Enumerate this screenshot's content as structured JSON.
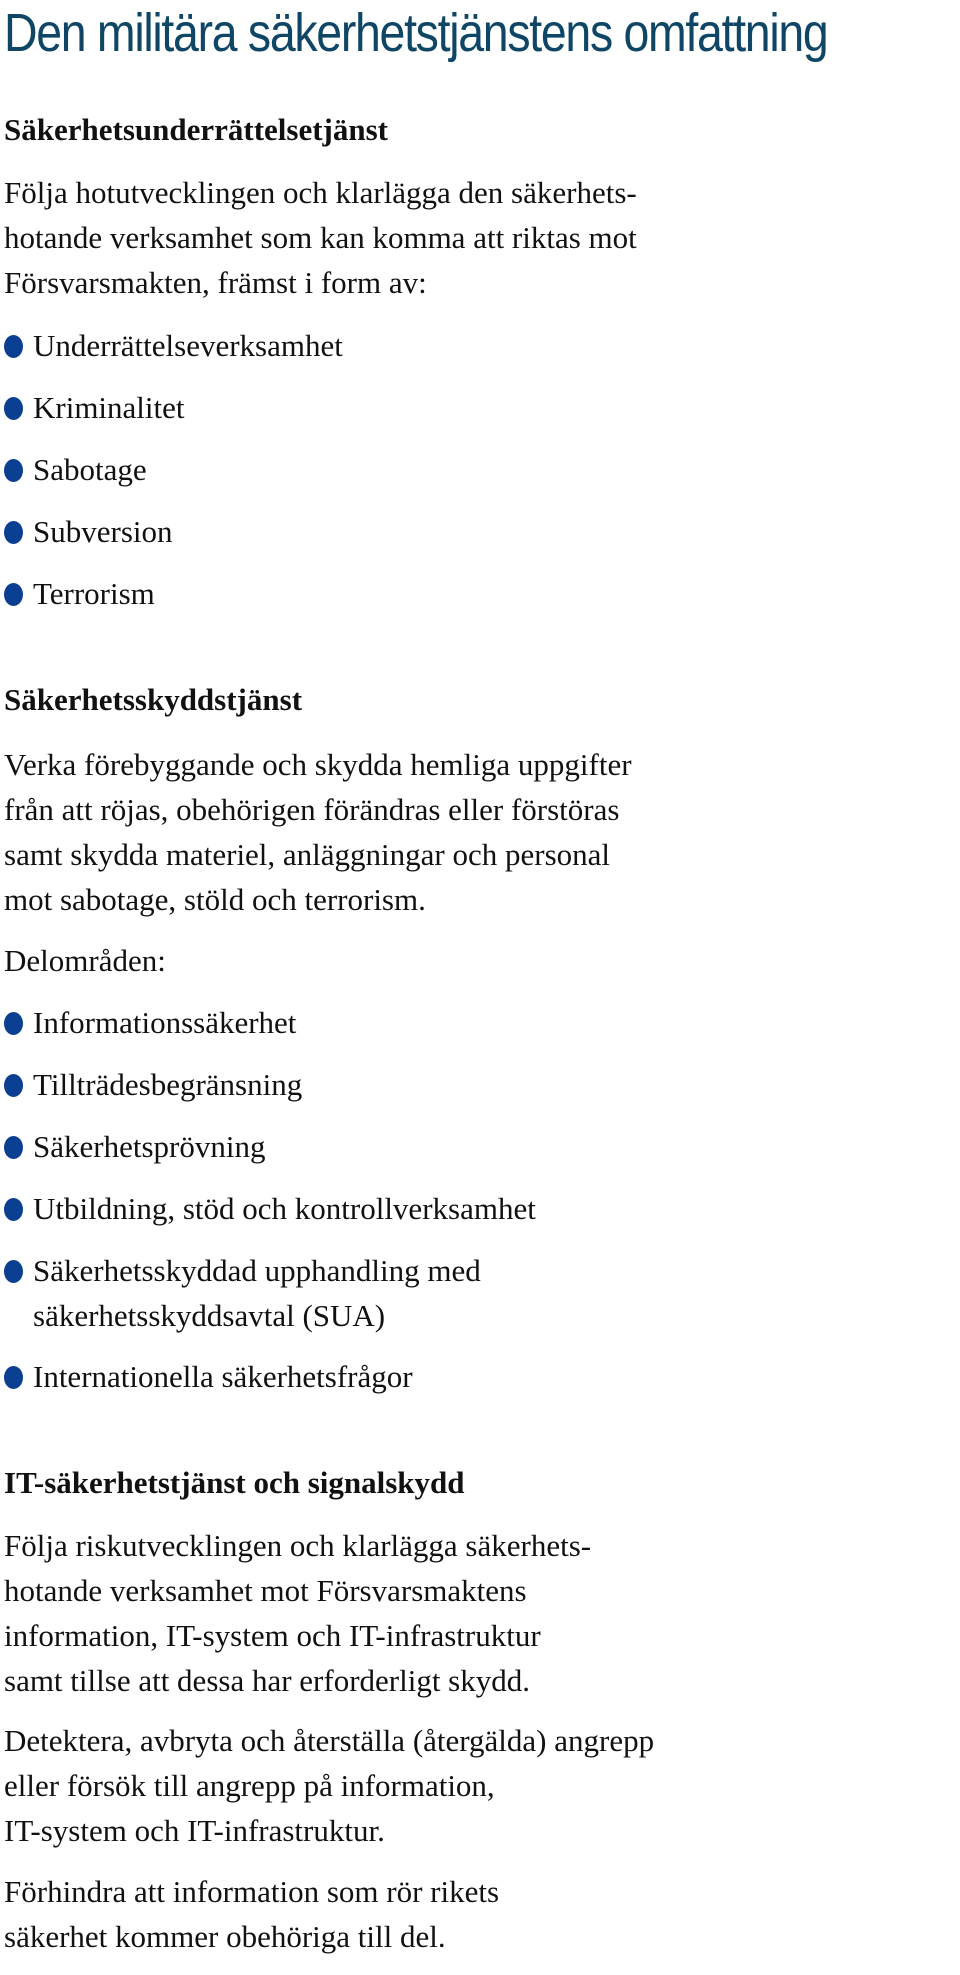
{
  "title": "Den militära säkerhetstjänstens omfattning",
  "accent_color": "#0f4665",
  "bullet_color": "#0b3f91",
  "sections": [
    {
      "heading": "Säkerhetsunderrättelsetjänst",
      "intro_lines": [
        "Följa hotutvecklingen och klarlägga den säkerhets-",
        "hotande verksamhet som kan komma att riktas mot",
        "Försvarsmakten, främst i form av:"
      ],
      "items": [
        "Underrättelseverksamhet",
        "Kriminalitet",
        "Sabotage",
        "Subversion",
        "Terrorism"
      ]
    },
    {
      "heading": "Säkerhetsskyddstjänst",
      "intro_lines": [
        "Verka förebyggande och skydda hemliga uppgifter",
        "från att röjas, obehörigen förändras eller förstöras",
        "samt skydda materiel, anläggningar och personal",
        "mot sabotage, stöld och terrorism."
      ],
      "sub_label": "Delområden:",
      "items": [
        "Informationssäkerhet",
        "Tillträdesbegränsning",
        "Säkerhetsprövning",
        "Utbildning, stöd och kontrollverksamhet",
        "Säkerhetsskyddad upphandling med",
        "Internationella säkerhetsfrågor"
      ],
      "item_5_continuation": "säkerhetsskyddsavtal (SUA)"
    },
    {
      "heading": "IT-säkerhetstjänst och signalskydd",
      "paragraphs": [
        [
          "Följa riskutvecklingen och klarlägga säkerhets-",
          "hotande verksamhet mot Försvarsmaktens",
          "information, IT-system och IT-infrastruktur",
          "samt tillse att dessa har erforderligt skydd."
        ],
        [
          "Detektera, avbryta och återställa (återgälda) angrepp",
          "eller försök till angrepp på information,",
          "IT-system och IT-infrastruktur."
        ],
        [
          "Förhindra att information som rör rikets",
          "säkerhet kommer obehöriga till del."
        ]
      ]
    }
  ]
}
